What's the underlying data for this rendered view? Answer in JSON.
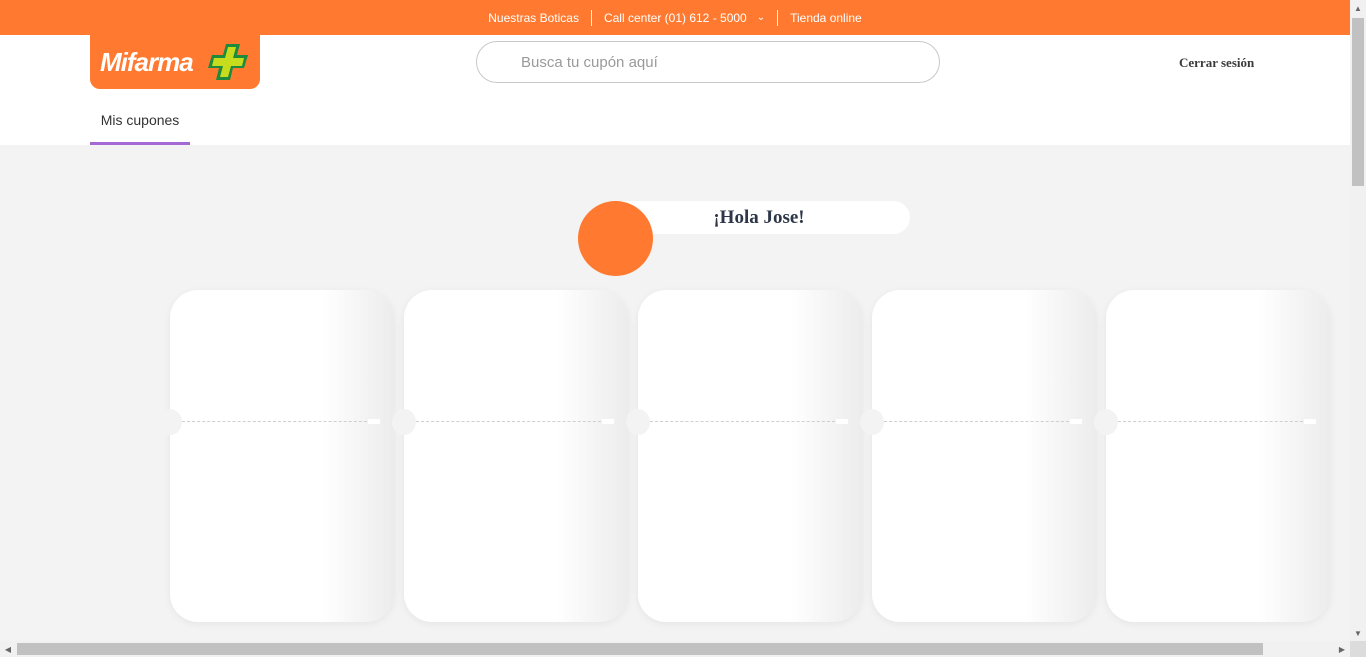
{
  "topbar": {
    "stores": "Nuestras Boticas",
    "call_center": "Call center (01) 612 - 5000",
    "online_store": "Tienda online"
  },
  "logo": {
    "text": "Mifarma"
  },
  "search": {
    "placeholder": "Busca tu cupón aquí"
  },
  "header": {
    "logout": "Cerrar sesión"
  },
  "tabs": [
    {
      "label": "Mis cupones",
      "active": true
    }
  ],
  "greeting": {
    "text": "¡Hola Jose!"
  },
  "coupons": {
    "count": 5
  },
  "colors": {
    "brand": "#ff7a30",
    "tab_underline": "#a569d6",
    "background": "#f3f3f3"
  }
}
